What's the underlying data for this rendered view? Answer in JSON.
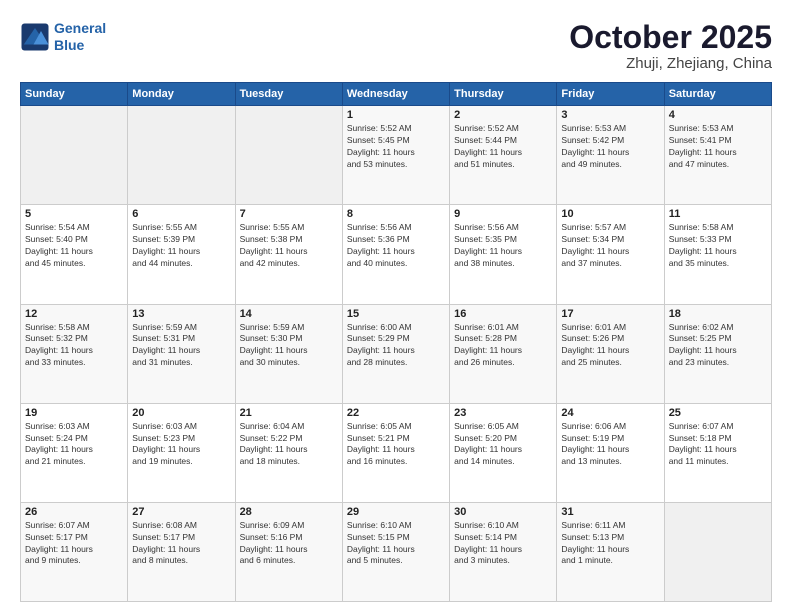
{
  "header": {
    "logo_line1": "General",
    "logo_line2": "Blue",
    "month": "October 2025",
    "location": "Zhuji, Zhejiang, China"
  },
  "days_of_week": [
    "Sunday",
    "Monday",
    "Tuesday",
    "Wednesday",
    "Thursday",
    "Friday",
    "Saturday"
  ],
  "weeks": [
    [
      {
        "day": "",
        "info": ""
      },
      {
        "day": "",
        "info": ""
      },
      {
        "day": "",
        "info": ""
      },
      {
        "day": "1",
        "info": "Sunrise: 5:52 AM\nSunset: 5:45 PM\nDaylight: 11 hours\nand 53 minutes."
      },
      {
        "day": "2",
        "info": "Sunrise: 5:52 AM\nSunset: 5:44 PM\nDaylight: 11 hours\nand 51 minutes."
      },
      {
        "day": "3",
        "info": "Sunrise: 5:53 AM\nSunset: 5:42 PM\nDaylight: 11 hours\nand 49 minutes."
      },
      {
        "day": "4",
        "info": "Sunrise: 5:53 AM\nSunset: 5:41 PM\nDaylight: 11 hours\nand 47 minutes."
      }
    ],
    [
      {
        "day": "5",
        "info": "Sunrise: 5:54 AM\nSunset: 5:40 PM\nDaylight: 11 hours\nand 45 minutes."
      },
      {
        "day": "6",
        "info": "Sunrise: 5:55 AM\nSunset: 5:39 PM\nDaylight: 11 hours\nand 44 minutes."
      },
      {
        "day": "7",
        "info": "Sunrise: 5:55 AM\nSunset: 5:38 PM\nDaylight: 11 hours\nand 42 minutes."
      },
      {
        "day": "8",
        "info": "Sunrise: 5:56 AM\nSunset: 5:36 PM\nDaylight: 11 hours\nand 40 minutes."
      },
      {
        "day": "9",
        "info": "Sunrise: 5:56 AM\nSunset: 5:35 PM\nDaylight: 11 hours\nand 38 minutes."
      },
      {
        "day": "10",
        "info": "Sunrise: 5:57 AM\nSunset: 5:34 PM\nDaylight: 11 hours\nand 37 minutes."
      },
      {
        "day": "11",
        "info": "Sunrise: 5:58 AM\nSunset: 5:33 PM\nDaylight: 11 hours\nand 35 minutes."
      }
    ],
    [
      {
        "day": "12",
        "info": "Sunrise: 5:58 AM\nSunset: 5:32 PM\nDaylight: 11 hours\nand 33 minutes."
      },
      {
        "day": "13",
        "info": "Sunrise: 5:59 AM\nSunset: 5:31 PM\nDaylight: 11 hours\nand 31 minutes."
      },
      {
        "day": "14",
        "info": "Sunrise: 5:59 AM\nSunset: 5:30 PM\nDaylight: 11 hours\nand 30 minutes."
      },
      {
        "day": "15",
        "info": "Sunrise: 6:00 AM\nSunset: 5:29 PM\nDaylight: 11 hours\nand 28 minutes."
      },
      {
        "day": "16",
        "info": "Sunrise: 6:01 AM\nSunset: 5:28 PM\nDaylight: 11 hours\nand 26 minutes."
      },
      {
        "day": "17",
        "info": "Sunrise: 6:01 AM\nSunset: 5:26 PM\nDaylight: 11 hours\nand 25 minutes."
      },
      {
        "day": "18",
        "info": "Sunrise: 6:02 AM\nSunset: 5:25 PM\nDaylight: 11 hours\nand 23 minutes."
      }
    ],
    [
      {
        "day": "19",
        "info": "Sunrise: 6:03 AM\nSunset: 5:24 PM\nDaylight: 11 hours\nand 21 minutes."
      },
      {
        "day": "20",
        "info": "Sunrise: 6:03 AM\nSunset: 5:23 PM\nDaylight: 11 hours\nand 19 minutes."
      },
      {
        "day": "21",
        "info": "Sunrise: 6:04 AM\nSunset: 5:22 PM\nDaylight: 11 hours\nand 18 minutes."
      },
      {
        "day": "22",
        "info": "Sunrise: 6:05 AM\nSunset: 5:21 PM\nDaylight: 11 hours\nand 16 minutes."
      },
      {
        "day": "23",
        "info": "Sunrise: 6:05 AM\nSunset: 5:20 PM\nDaylight: 11 hours\nand 14 minutes."
      },
      {
        "day": "24",
        "info": "Sunrise: 6:06 AM\nSunset: 5:19 PM\nDaylight: 11 hours\nand 13 minutes."
      },
      {
        "day": "25",
        "info": "Sunrise: 6:07 AM\nSunset: 5:18 PM\nDaylight: 11 hours\nand 11 minutes."
      }
    ],
    [
      {
        "day": "26",
        "info": "Sunrise: 6:07 AM\nSunset: 5:17 PM\nDaylight: 11 hours\nand 9 minutes."
      },
      {
        "day": "27",
        "info": "Sunrise: 6:08 AM\nSunset: 5:17 PM\nDaylight: 11 hours\nand 8 minutes."
      },
      {
        "day": "28",
        "info": "Sunrise: 6:09 AM\nSunset: 5:16 PM\nDaylight: 11 hours\nand 6 minutes."
      },
      {
        "day": "29",
        "info": "Sunrise: 6:10 AM\nSunset: 5:15 PM\nDaylight: 11 hours\nand 5 minutes."
      },
      {
        "day": "30",
        "info": "Sunrise: 6:10 AM\nSunset: 5:14 PM\nDaylight: 11 hours\nand 3 minutes."
      },
      {
        "day": "31",
        "info": "Sunrise: 6:11 AM\nSunset: 5:13 PM\nDaylight: 11 hours\nand 1 minute."
      },
      {
        "day": "",
        "info": ""
      }
    ]
  ]
}
